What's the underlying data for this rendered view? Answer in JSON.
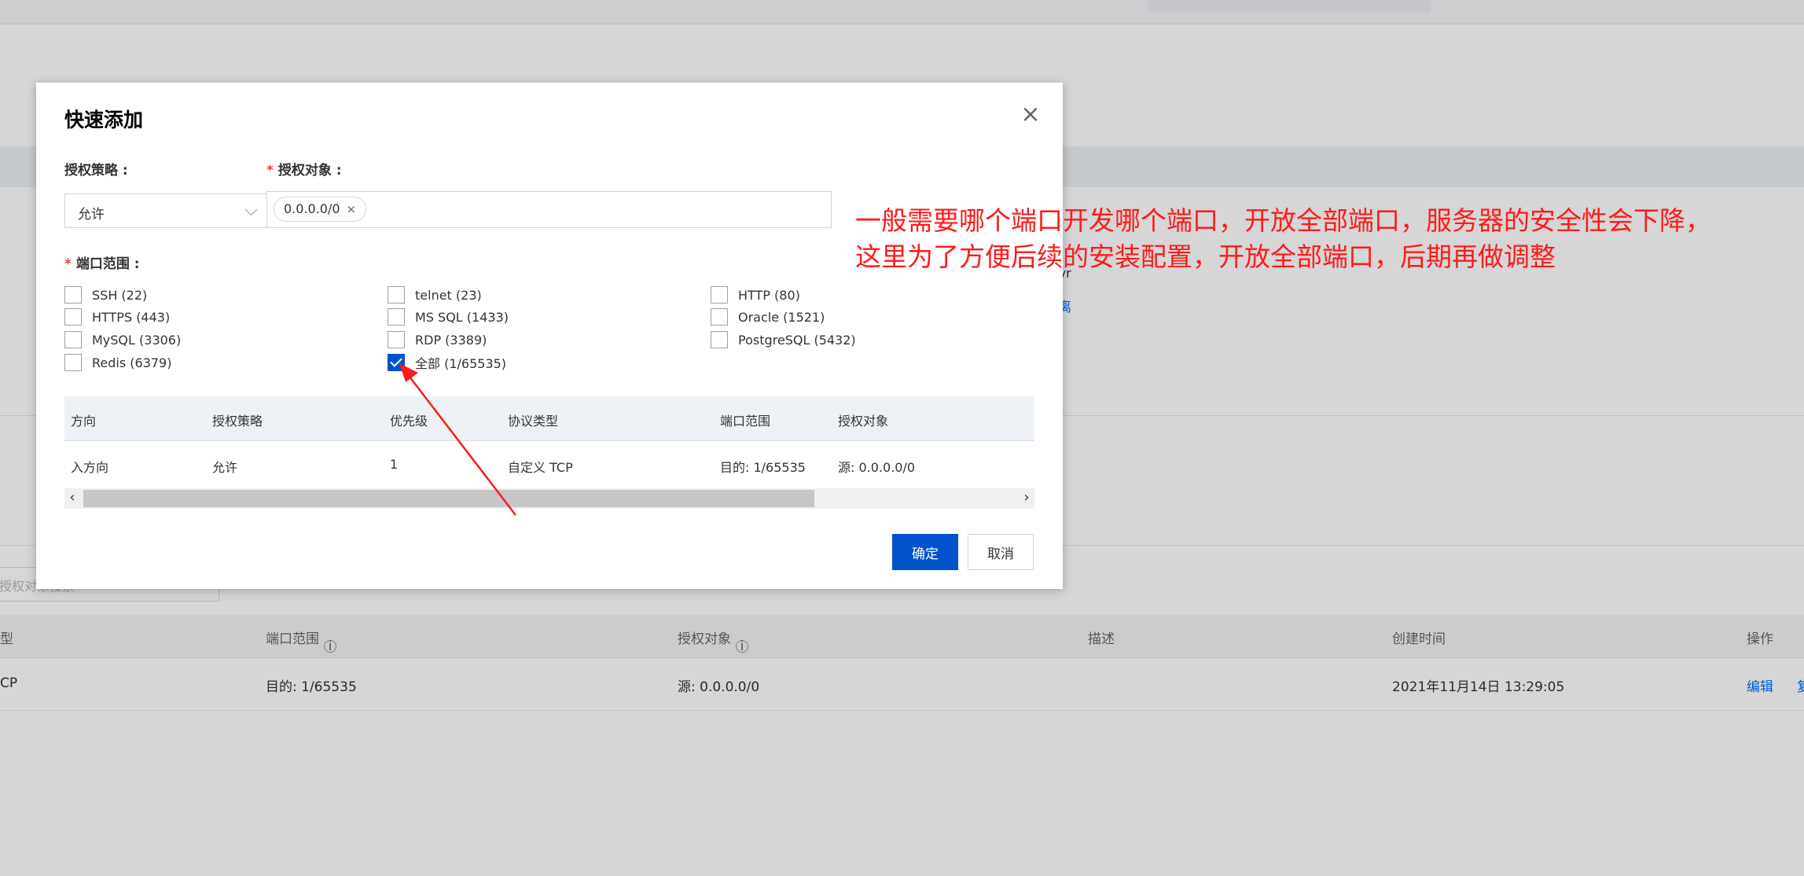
{
  "background": {
    "side_text": "kyr",
    "side_link": "离",
    "search_placeholder": "授权对象搜索",
    "table": {
      "headers": [
        "型",
        "端口范围",
        "授权对象",
        "描述",
        "创建时间",
        "操作"
      ],
      "row": {
        "protocol": "CP",
        "port_range": "目的: 1/65535",
        "object": "源: 0.0.0.0/0",
        "description": "",
        "created_at": "2021年11月14日 13:29:05",
        "edit": "编辑",
        "more": "复"
      }
    }
  },
  "dialog": {
    "title": "快速添加",
    "policy_label": "授权策略 :",
    "policy_value": "允许",
    "object_label": "授权对象 :",
    "object_tag": "0.0.0.0/0",
    "port_label": "端口范围 :",
    "ports": [
      {
        "label": "SSH (22)",
        "checked": false
      },
      {
        "label": "telnet (23)",
        "checked": false
      },
      {
        "label": "HTTP (80)",
        "checked": false
      },
      {
        "label": "HTTPS (443)",
        "checked": false
      },
      {
        "label": "MS SQL (1433)",
        "checked": false
      },
      {
        "label": "Oracle (1521)",
        "checked": false
      },
      {
        "label": "MySQL (3306)",
        "checked": false
      },
      {
        "label": "RDP (3389)",
        "checked": false
      },
      {
        "label": "PostgreSQL (5432)",
        "checked": false
      },
      {
        "label": "Redis (6379)",
        "checked": false
      },
      {
        "label": "全部 (1/65535)",
        "checked": true
      }
    ],
    "table": {
      "headers": [
        "方向",
        "授权策略",
        "优先级",
        "协议类型",
        "端口范围",
        "授权对象"
      ],
      "row": [
        "入方向",
        "允许",
        "1",
        "自定义 TCP",
        "目的: 1/65535",
        "源: 0.0.0.0/0"
      ]
    },
    "confirm": "确定",
    "cancel": "取消"
  },
  "annotation": {
    "line1": "一般需要哪个端口开发哪个端口，开放全部端口，服务器的安全性会下降，",
    "line2": "这里为了方便后续的安装配置，开放全部端口，后期再做调整",
    "color": "#ff1a1a"
  },
  "colors": {
    "primary": "#0052cc",
    "link": "#006eff",
    "required": "#e54545"
  }
}
